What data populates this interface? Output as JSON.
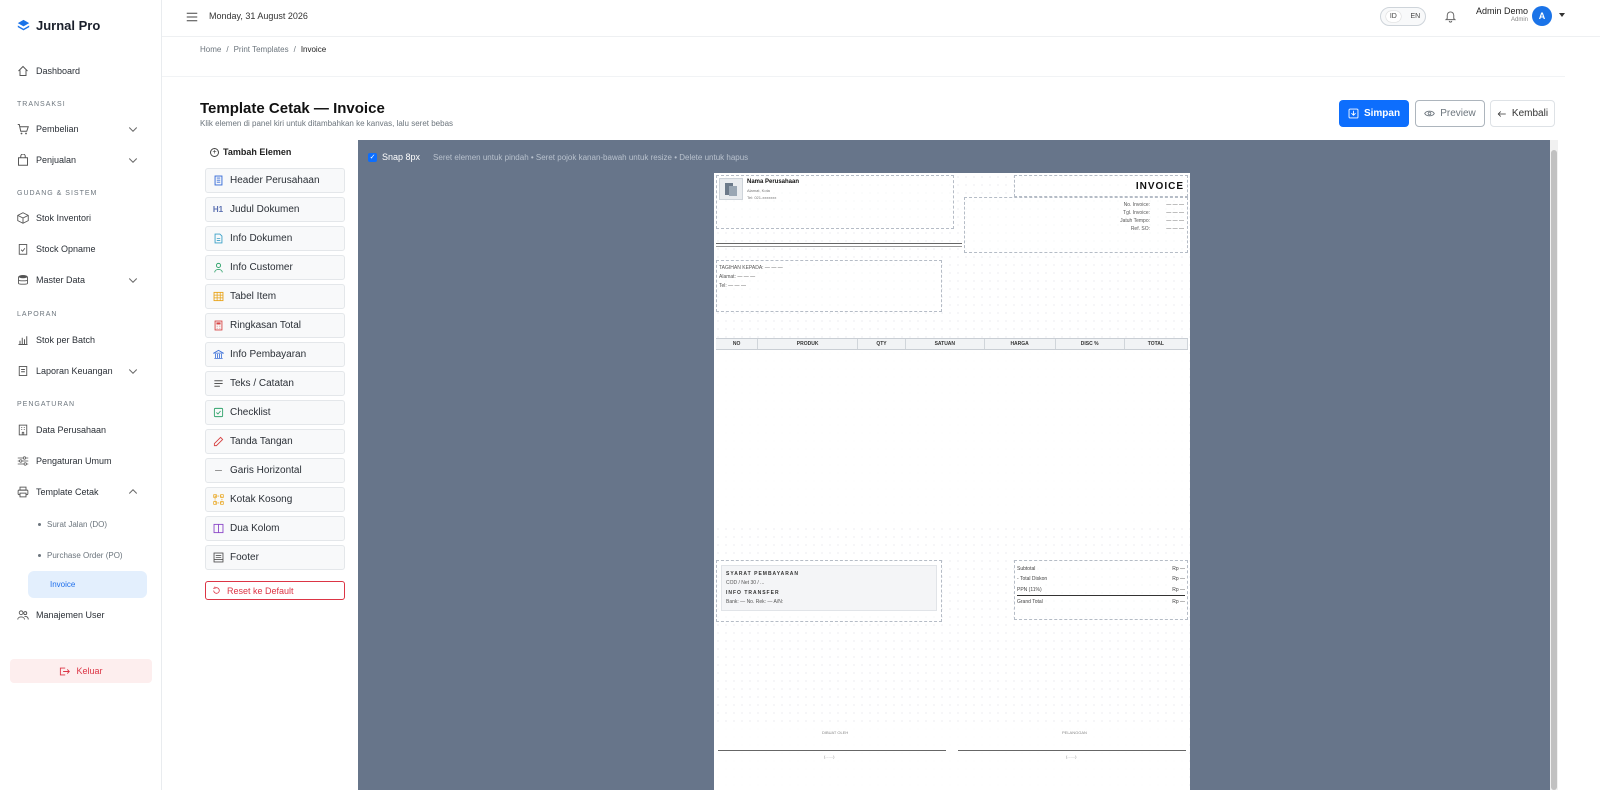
{
  "app": {
    "brand": "Jurnal Pro"
  },
  "sidebar": {
    "dashboard": "Dashboard",
    "sections": {
      "transaksi": "TRANSAKSI",
      "gudang": "GUDANG & SISTEM",
      "laporan": "LAPORAN",
      "pengaturan": "PENGATURAN"
    },
    "items": {
      "pembelian": "Pembelian",
      "penjualan": "Penjualan",
      "stok_inventori": "Stok Inventori",
      "stock_opname": "Stock Opname",
      "master_data": "Master Data",
      "stok_batch": "Stok per Batch",
      "laporan_keuangan": "Laporan Keuangan",
      "data_perusahaan": "Data Perusahaan",
      "pengaturan_umum": "Pengaturan Umum",
      "template_cetak": "Template Cetak",
      "manajemen_user": "Manajemen User"
    },
    "sub_items": {
      "surat_jalan": "Surat Jalan (DO)",
      "purchase_order": "Purchase Order (PO)",
      "invoice": "Invoice"
    },
    "logout": "Keluar"
  },
  "topbar": {
    "date": "Monday, 31 August 2026",
    "lang_id": "ID",
    "lang_en": "EN",
    "user_name": "Admin Demo",
    "user_role": "Admin",
    "avatar_initial": "A"
  },
  "breadcrumb": {
    "home": "Home",
    "sep": "/",
    "print_templates": "Print Templates",
    "current": "Invoice"
  },
  "page": {
    "title": "Template Cetak — Invoice",
    "subtitle": "Klik elemen di panel kiri untuk ditambahkan ke kanvas, lalu seret bebas"
  },
  "actions": {
    "save": "Simpan",
    "preview": "Preview",
    "back": "Kembali"
  },
  "panel": {
    "title": "Tambah Elemen",
    "elements": [
      {
        "label": "Header Perusahaan",
        "icon": "building-icon",
        "color": "#3b6fd8"
      },
      {
        "label": "Judul Dokumen",
        "icon": "H1",
        "color": "#5a6fb0"
      },
      {
        "label": "Info Dokumen",
        "icon": "document-icon",
        "color": "#3aa0c8"
      },
      {
        "label": "Info Customer",
        "icon": "person-icon",
        "color": "#2fa36b"
      },
      {
        "label": "Tabel Item",
        "icon": "table-icon",
        "color": "#e8a317"
      },
      {
        "label": "Ringkasan Total",
        "icon": "calculator-icon",
        "color": "#d64545"
      },
      {
        "label": "Info Pembayaran",
        "icon": "bank-icon",
        "color": "#3b6fd8"
      },
      {
        "label": "Teks / Catatan",
        "icon": "text-icon",
        "color": "#555555"
      },
      {
        "label": "Checklist",
        "icon": "checkbox-icon",
        "color": "#2fa36b"
      },
      {
        "label": "Tanda Tangan",
        "icon": "pen-icon",
        "color": "#d64545"
      },
      {
        "label": "Garis Horizontal",
        "icon": "dash-icon",
        "color": "#888888"
      },
      {
        "label": "Kotak Kosong",
        "icon": "bounding-box-icon",
        "color": "#e8a317"
      },
      {
        "label": "Dua Kolom",
        "icon": "columns-icon",
        "color": "#8a45c8"
      },
      {
        "label": "Footer",
        "icon": "footer-icon",
        "color": "#555555"
      }
    ],
    "reset": "Reset ke Default"
  },
  "canvas": {
    "snap_label": "Snap 8px",
    "hint": "Seret elemen untuk pindah • Seret pojok kanan-bawah untuk resize • Delete untuk hapus"
  },
  "invoice": {
    "company_name": "Nama Perusahaan",
    "company_addr": "Alamat, Kota",
    "company_tel": "Tel: 021-xxxxxxx",
    "title": "INVOICE",
    "meta": [
      {
        "label": "No. Invoice:",
        "value": "— — —"
      },
      {
        "label": "Tgl. Invoice:",
        "value": "— — —"
      },
      {
        "label": "Jatuh Tempo:",
        "value": "— — —"
      },
      {
        "label": "Ref. SO:",
        "value": "— — —"
      }
    ],
    "bill_to": "TAGIHAN KEPADA: — — —",
    "bill_addr": "Alamat: — — —",
    "bill_tel": "Tel: — — —",
    "columns": [
      "NO",
      "PRODUK",
      "QTY",
      "SATUAN",
      "HARGA",
      "DISC %",
      "TOTAL"
    ],
    "payment_terms_label": "SYARAT PEMBAYARAN",
    "payment_terms": "COD / Net 30 / ...",
    "transfer_label": "INFO TRANSFER",
    "transfer": "Bank: — No. Rek: — A/N:",
    "summary": [
      {
        "label": "Subtotal",
        "value": "Rp —"
      },
      {
        "label": "- Total Diskon",
        "value": "Rp —"
      },
      {
        "label": "PPN (11%)",
        "value": "Rp —"
      },
      {
        "label": "Grand Total",
        "value": "Rp —"
      }
    ],
    "sig_left": "DIBUAT OLEH",
    "sig_right": "PELANGGAN",
    "sig_placeholder": "(.......)"
  }
}
